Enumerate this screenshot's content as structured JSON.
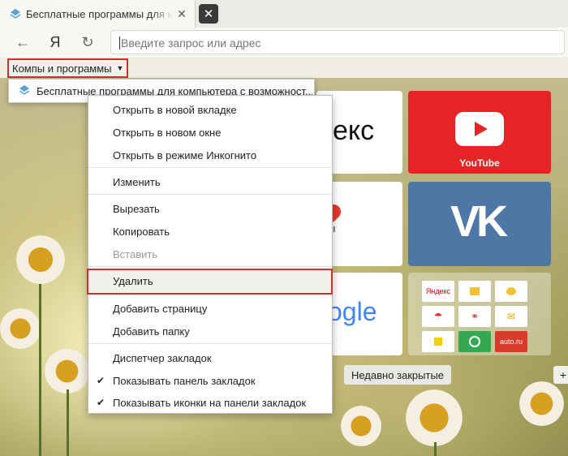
{
  "tabs": [
    {
      "title": "Бесплатные программы для компьютера"
    }
  ],
  "toolbar": {
    "back_icon": "←",
    "yandex_icon": "Я",
    "reload_icon": "↻",
    "address_placeholder": "Введите запрос или адрес"
  },
  "bookmarks_bar": {
    "folder_label": "Компы и программы",
    "folder_arrow": "▼"
  },
  "submenu": {
    "item_label": "Бесплатные программы для компьютера с возможност..."
  },
  "context_menu": {
    "items": [
      {
        "label": "Открыть в новой вкладке",
        "checked": "",
        "disabled": false
      },
      {
        "label": "Открыть в новом окне",
        "checked": "",
        "disabled": false
      },
      {
        "label": "Открыть в режиме Инкогнито",
        "checked": "",
        "disabled": false
      },
      {
        "label": "Изменить",
        "checked": "",
        "disabled": false
      },
      {
        "label": "Вырезать",
        "checked": "",
        "disabled": false
      },
      {
        "label": "Копировать",
        "checked": "",
        "disabled": false
      },
      {
        "label": "Вставить",
        "checked": "",
        "disabled": true
      },
      {
        "label": "Удалить",
        "checked": "",
        "disabled": false
      },
      {
        "label": "Добавить страницу",
        "checked": "",
        "disabled": false
      },
      {
        "label": "Добавить папку",
        "checked": "",
        "disabled": false
      },
      {
        "label": "Диспетчер закладок",
        "checked": "",
        "disabled": false
      },
      {
        "label": "Показывать панель закладок",
        "checked": "✔",
        "disabled": false
      },
      {
        "label": "Показывать иконки на панели закладок",
        "checked": "✔",
        "disabled": false
      }
    ]
  },
  "tiles": {
    "yandex_text": "екс",
    "youtube_label": "YouTube",
    "maps_text": "ты",
    "google_text": "ogle",
    "mini": [
      "Яндекс",
      "",
      "",
      "",
      "",
      "",
      "",
      "",
      "auto.ru"
    ]
  },
  "bottom": {
    "recent_label": "Недавно закрытые",
    "plus_icon": "+"
  },
  "colors": {
    "highlight": "#d23030",
    "youtube": "#e52525",
    "vk": "#4f77a6"
  }
}
